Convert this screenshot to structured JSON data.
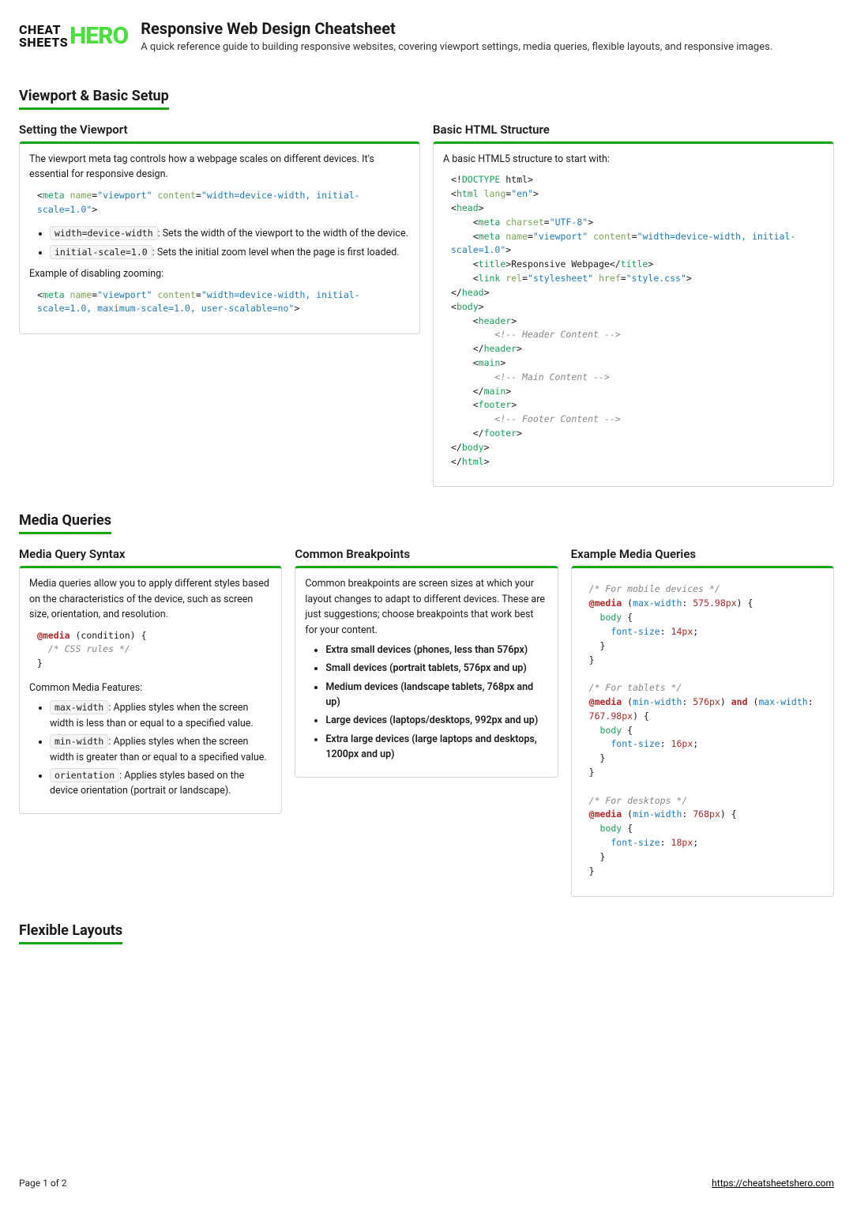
{
  "logo": {
    "left_top": "CHEAT",
    "left_bottom": "SHEETS",
    "right": "HERO"
  },
  "header": {
    "title": "Responsive Web Design Cheatsheet",
    "subtitle": "A quick reference guide to building responsive websites, covering viewport settings, media queries, flexible layouts, and responsive images."
  },
  "sections": {
    "viewport": {
      "heading": "Viewport & Basic Setup",
      "left": {
        "title": "Setting the Viewport",
        "intro": "The viewport meta tag controls how a webpage scales on different devices. It's essential for responsive design.",
        "code1": {
          "name": "viewport",
          "content": "width=device-width, initial-scale=1.0"
        },
        "list": [
          {
            "code": "width=device-width",
            "text": ": Sets the width of the viewport to the width of the device."
          },
          {
            "code": "initial-scale=1.0",
            "text": ": Sets the initial zoom level when the page is first loaded."
          }
        ],
        "disable_label": "Example of disabling zooming:",
        "code2": {
          "name": "viewport",
          "content": "width=device-width, initial-scale=1.0, maximum-scale=1.0, user-scalable=no"
        }
      },
      "right": {
        "title": "Basic HTML Structure",
        "intro": "A basic HTML5 structure to start with:",
        "html": {
          "lang": "en",
          "charset": "UTF-8",
          "meta_name": "viewport",
          "meta_content": "width=device-width, initial-scale=1.0",
          "page_title": "Responsive Webpage",
          "link_rel": "stylesheet",
          "link_href": "style.css",
          "comment_header": "<!-- Header Content -->",
          "comment_main": "<!-- Main Content -->",
          "comment_footer": "<!-- Footer Content -->"
        }
      }
    },
    "media": {
      "heading": "Media Queries",
      "syntax": {
        "title": "Media Query Syntax",
        "intro": "Media queries allow you to apply different styles based on the characteristics of the device, such as screen size, orientation, and resolution.",
        "code": {
          "kw": "@media",
          "cond": "(condition) {",
          "comment": "/* CSS rules */",
          "close": "}"
        },
        "features_label": "Common Media Features:",
        "features": [
          {
            "code": "max-width",
            "text": ": Applies styles when the screen width is less than or equal to a specified value."
          },
          {
            "code": "min-width",
            "text": ": Applies styles when the screen width is greater than or equal to a specified value."
          },
          {
            "code": "orientation",
            "text": ": Applies styles based on the device orientation (portrait or landscape)."
          }
        ]
      },
      "breakpoints": {
        "title": "Common Breakpoints",
        "intro": "Common breakpoints are screen sizes at which your layout changes to adapt to different devices. These are just suggestions; choose breakpoints that work best for your content.",
        "items": [
          "Extra small devices (phones, less than 576px)",
          "Small devices (portrait tablets, 576px and up)",
          "Medium devices (landscape tablets, 768px and up)",
          "Large devices (laptops/desktops, 992px and up)",
          "Extra large devices (large laptops and desktops, 1200px and up)"
        ]
      },
      "examples": {
        "title": "Example Media Queries",
        "blocks": [
          {
            "comment": "/* For mobile devices */",
            "q": "max-width",
            "v": "575.98",
            "fs": "14"
          },
          {
            "comment": "/* For tablets */",
            "q1": "min-width",
            "v1": "576",
            "q2": "max-width",
            "v2": "767.98",
            "fs": "16"
          },
          {
            "comment": "/* For desktops */",
            "q": "min-width",
            "v": "768",
            "fs": "18"
          }
        ]
      }
    },
    "flex": {
      "heading": "Flexible Layouts"
    }
  },
  "footer": {
    "page": "Page 1 of 2",
    "url": "https://cheatsheetshero.com"
  }
}
